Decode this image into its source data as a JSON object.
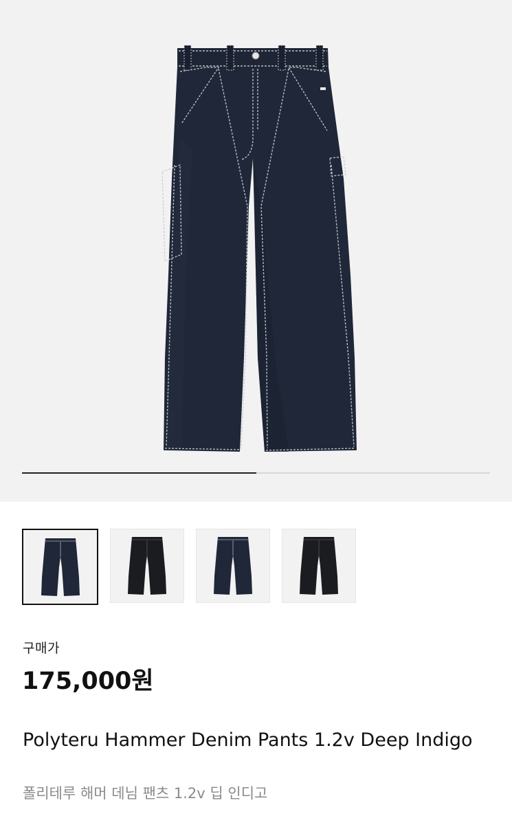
{
  "product": {
    "image_alt": "Deep Indigo denim pants",
    "gallery_progress_fraction": 0.5,
    "thumbnails": [
      {
        "name": "thumbnail-deep-indigo-front",
        "color": "#1f2738",
        "selected": true
      },
      {
        "name": "thumbnail-black-front",
        "color": "#1b1c1f",
        "selected": false
      },
      {
        "name": "thumbnail-deep-indigo-back",
        "color": "#1f2738",
        "selected": false
      },
      {
        "name": "thumbnail-black-back",
        "color": "#1b1c1f",
        "selected": false
      }
    ],
    "price_label": "구매가",
    "price": "175,000원",
    "title": "Polyteru Hammer Denim Pants 1.2v Deep Indigo",
    "subtitle": "폴리테루 해머 데님 팬츠 1.2v 딥 인디고"
  },
  "colors": {
    "hero_background": "#f2f2f2",
    "denim": "#1f2738",
    "stitch": "#c9ccd3",
    "price_text": "#111111",
    "subtitle_text": "#8a8a8a"
  }
}
